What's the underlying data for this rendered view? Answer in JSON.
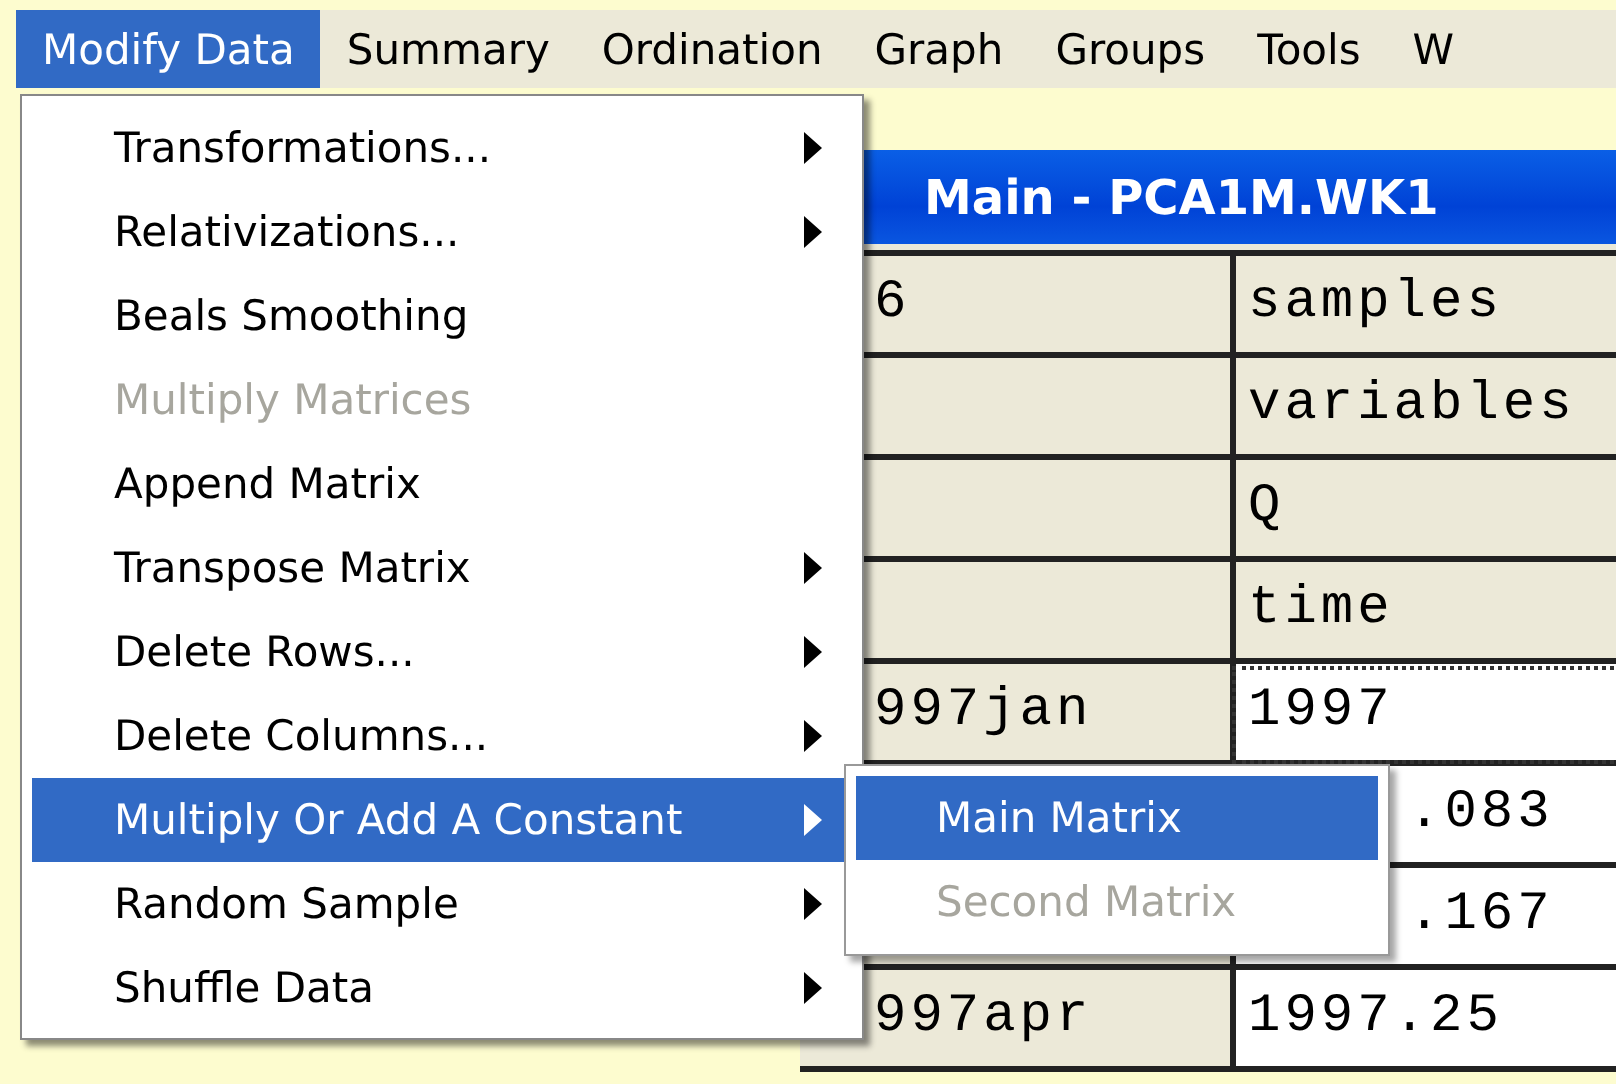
{
  "menubar": [
    {
      "label": "Modify Data",
      "selected": true
    },
    {
      "label": "Summary",
      "selected": false
    },
    {
      "label": "Ordination",
      "selected": false
    },
    {
      "label": "Graph",
      "selected": false
    },
    {
      "label": "Groups",
      "selected": false
    },
    {
      "label": "Tools",
      "selected": false
    },
    {
      "label": "W",
      "selected": false
    }
  ],
  "window": {
    "title": "Main - PCA1M.WK1",
    "rows": [
      {
        "cells": [
          {
            "text": "6"
          },
          {
            "text": "samples"
          }
        ]
      },
      {
        "cells": [
          null,
          {
            "text": "variables"
          }
        ]
      },
      {
        "cells": [
          null,
          {
            "text": "Q"
          }
        ]
      },
      {
        "cells": [
          null,
          {
            "text": "time"
          }
        ]
      },
      {
        "cells": [
          {
            "text": "997jan"
          },
          {
            "text": "1997",
            "selected": true
          }
        ]
      },
      {
        "cells": [
          null,
          {
            "text": ".083",
            "cut": true
          }
        ]
      },
      {
        "cells": [
          null,
          {
            "text": ".167",
            "cut": true
          }
        ]
      },
      {
        "cells": [
          {
            "text": "997apr"
          },
          {
            "text": "1997.25"
          }
        ]
      }
    ]
  },
  "menu": [
    {
      "label": "Transformations...",
      "submenu": true,
      "disabled": false,
      "selected": false
    },
    {
      "label": "Relativizations...",
      "submenu": true,
      "disabled": false,
      "selected": false
    },
    {
      "label": "Beals Smoothing",
      "submenu": false,
      "disabled": false,
      "selected": false
    },
    {
      "label": "Multiply Matrices",
      "submenu": false,
      "disabled": true,
      "selected": false
    },
    {
      "label": "Append Matrix",
      "submenu": false,
      "disabled": false,
      "selected": false
    },
    {
      "label": "Transpose Matrix",
      "submenu": true,
      "disabled": false,
      "selected": false
    },
    {
      "label": "Delete Rows...",
      "submenu": true,
      "disabled": false,
      "selected": false
    },
    {
      "label": "Delete Columns...",
      "submenu": true,
      "disabled": false,
      "selected": false
    },
    {
      "label": "Multiply Or Add A Constant",
      "submenu": true,
      "disabled": false,
      "selected": true
    },
    {
      "label": "Random Sample",
      "submenu": true,
      "disabled": false,
      "selected": false
    },
    {
      "label": "Shuffle Data",
      "submenu": true,
      "disabled": false,
      "selected": false
    }
  ],
  "submenu": [
    {
      "label": "Main Matrix",
      "disabled": false,
      "selected": true
    },
    {
      "label": "Second Matrix",
      "disabled": true,
      "selected": false
    }
  ]
}
